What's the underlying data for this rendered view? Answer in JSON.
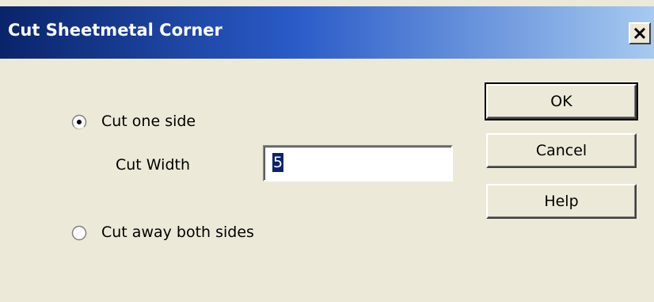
{
  "dialog": {
    "title": "Cut Sheetmetal Corner",
    "close_icon": "close-icon"
  },
  "options": {
    "cut_one_side": {
      "label": "Cut one side",
      "selected": true
    },
    "cut_width": {
      "label": "Cut Width",
      "value": "5"
    },
    "cut_both_sides": {
      "label": "Cut away both sides",
      "selected": false
    }
  },
  "buttons": {
    "ok": "OK",
    "cancel": "Cancel",
    "help": "Help"
  }
}
